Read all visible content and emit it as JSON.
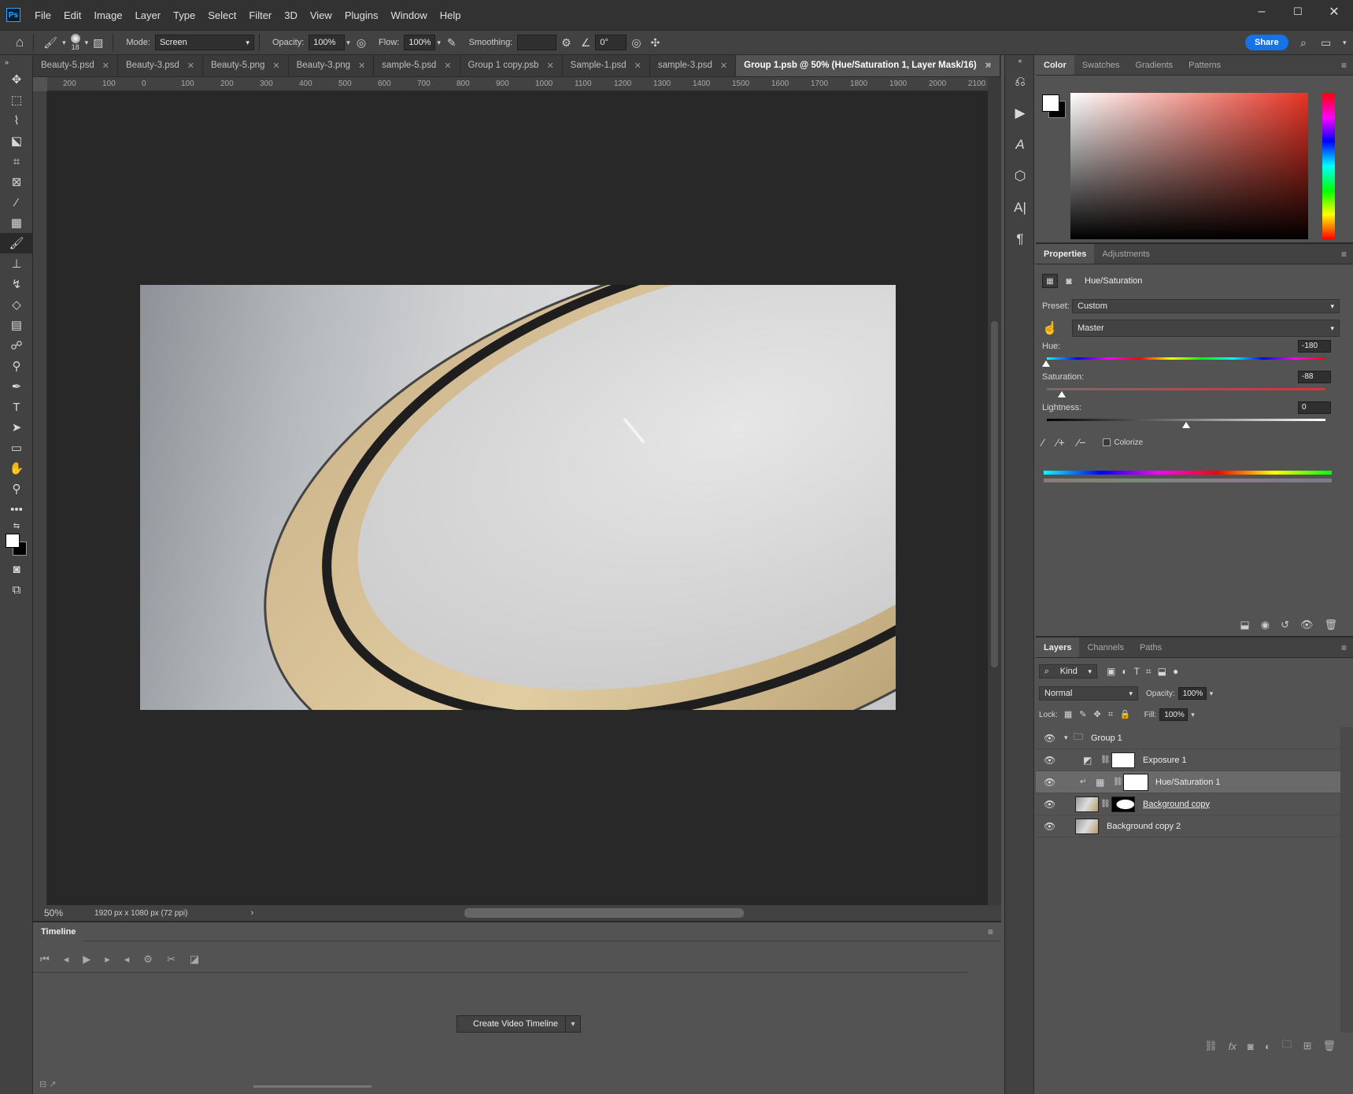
{
  "menubar": {
    "logo": "Ps",
    "items": [
      "File",
      "Edit",
      "Image",
      "Layer",
      "Type",
      "Select",
      "Filter",
      "3D",
      "View",
      "Plugins",
      "Window",
      "Help"
    ],
    "window_controls": [
      "–",
      "☐",
      "✕"
    ]
  },
  "options": {
    "brush_size": "18",
    "mode_label": "Mode:",
    "mode_value": "Screen",
    "opacity_label": "Opacity:",
    "opacity_value": "100%",
    "flow_label": "Flow:",
    "flow_value": "100%",
    "smoothing_label": "Smoothing:",
    "smoothing_value": "",
    "angle_value": "0°",
    "share_label": "Share"
  },
  "document_tabs": [
    {
      "label": "Beauty-5.psd",
      "active": false
    },
    {
      "label": "Beauty-3.psd",
      "active": false
    },
    {
      "label": "Beauty-5.png",
      "active": false
    },
    {
      "label": "Beauty-3.png",
      "active": false
    },
    {
      "label": "sample-5.psd",
      "active": false
    },
    {
      "label": "Group 1 copy.psb",
      "active": false
    },
    {
      "label": "Sample-1.psd",
      "active": false
    },
    {
      "label": "sample-3.psd",
      "active": false
    },
    {
      "label": "Group 1.psb @ 50% (Hue/Saturation 1, Layer Mask/16)",
      "active": true
    }
  ],
  "ruler_ticks": [
    "200",
    "100",
    "0",
    "100",
    "200",
    "300",
    "400",
    "500",
    "600",
    "700",
    "800",
    "900",
    "1000",
    "1100",
    "1200",
    "1300",
    "1400",
    "1500",
    "1600",
    "1700",
    "1800",
    "1900",
    "2000",
    "2100"
  ],
  "status": {
    "zoom": "50%",
    "doc_info": "1920 px x 1080 px (72 ppi)"
  },
  "timeline": {
    "title": "Timeline",
    "create_button": "Create Video Timeline"
  },
  "color_panel": {
    "tabs": [
      "Color",
      "Swatches",
      "Gradients",
      "Patterns"
    ],
    "active": "Color",
    "foreground": "#ffffff",
    "background": "#000000"
  },
  "properties": {
    "tabs": [
      "Properties",
      "Adjustments"
    ],
    "active": "Properties",
    "adjustment_title": "Hue/Saturation",
    "preset_label": "Preset:",
    "preset_value": "Custom",
    "channel_value": "Master",
    "hue_label": "Hue:",
    "hue_value": "-180",
    "saturation_label": "Saturation:",
    "saturation_value": "-88",
    "lightness_label": "Lightness:",
    "lightness_value": "0",
    "colorize_label": "Colorize"
  },
  "layers_panel": {
    "tabs": [
      "Layers",
      "Channels",
      "Paths"
    ],
    "active": "Layers",
    "filter_kind": "Kind",
    "blend_mode": "Normal",
    "opacity_label": "Opacity:",
    "opacity_value": "100%",
    "lock_label": "Lock:",
    "fill_label": "Fill:",
    "fill_value": "100%",
    "layers": [
      {
        "name": "Group 1",
        "type": "group",
        "selected": false
      },
      {
        "name": "Exposure 1",
        "type": "adjustment",
        "selected": false
      },
      {
        "name": "Hue/Saturation 1",
        "type": "adjustment",
        "selected": true
      },
      {
        "name": "Background copy",
        "type": "image",
        "selected": false
      },
      {
        "name": "Background copy 2",
        "type": "image",
        "selected": false
      }
    ]
  }
}
